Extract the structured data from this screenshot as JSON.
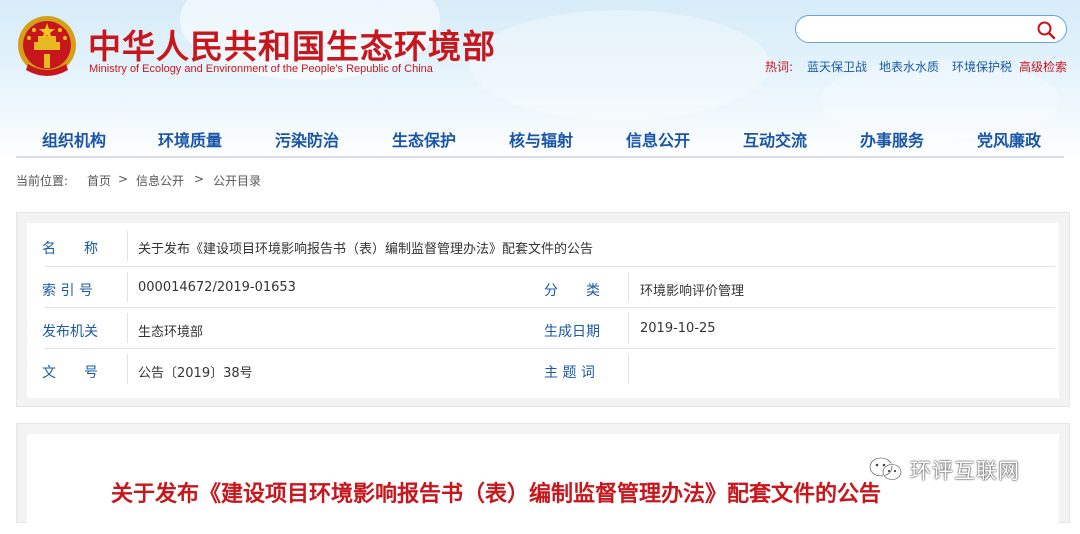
{
  "site": {
    "title_cn": "中华人民共和国生态环境部",
    "title_en": "Ministry of Ecology and Environment of the People's Republic of China"
  },
  "search": {
    "value": "",
    "placeholder": ""
  },
  "hot": {
    "label": "热词:",
    "links": [
      "蓝天保卫战",
      "地表水水质",
      "环境保护税"
    ],
    "advanced": "高级检索"
  },
  "nav": [
    "组织机构",
    "环境质量",
    "污染防治",
    "生态保护",
    "核与辐射",
    "信息公开",
    "互动交流",
    "办事服务",
    "党风廉政"
  ],
  "breadcrumb": {
    "label": "当前位置:",
    "items": [
      "首页",
      "信息公开",
      "公开目录"
    ],
    "sep": ">"
  },
  "info": {
    "name_label": "名　　称",
    "name_value": "关于发布《建设项目环境影响报告书（表）编制监督管理办法》配套文件的公告",
    "index_label": "索 引 号",
    "index_value": "000014672/2019-01653",
    "category_label": "分　　类",
    "category_value": "环境影响评价管理",
    "issuer_label": "发布机关",
    "issuer_value": "生态环境部",
    "date_label": "生成日期",
    "date_value": "2019-10-25",
    "doc_label": "文　　号",
    "doc_value": "公告〔2019〕38号",
    "keywords_label": "主 题 词",
    "keywords_value": ""
  },
  "article": {
    "title": "关于发布《建设项目环境影响报告书（表）编制监督管理办法》配套文件的公告"
  },
  "watermark": {
    "text": "环评互联网"
  },
  "colors": {
    "red": "#c8161d",
    "blue": "#1a56a8",
    "link": "#1a5aa6"
  },
  "icons": [
    "national-emblem-icon",
    "search-icon",
    "wechat-icon"
  ]
}
